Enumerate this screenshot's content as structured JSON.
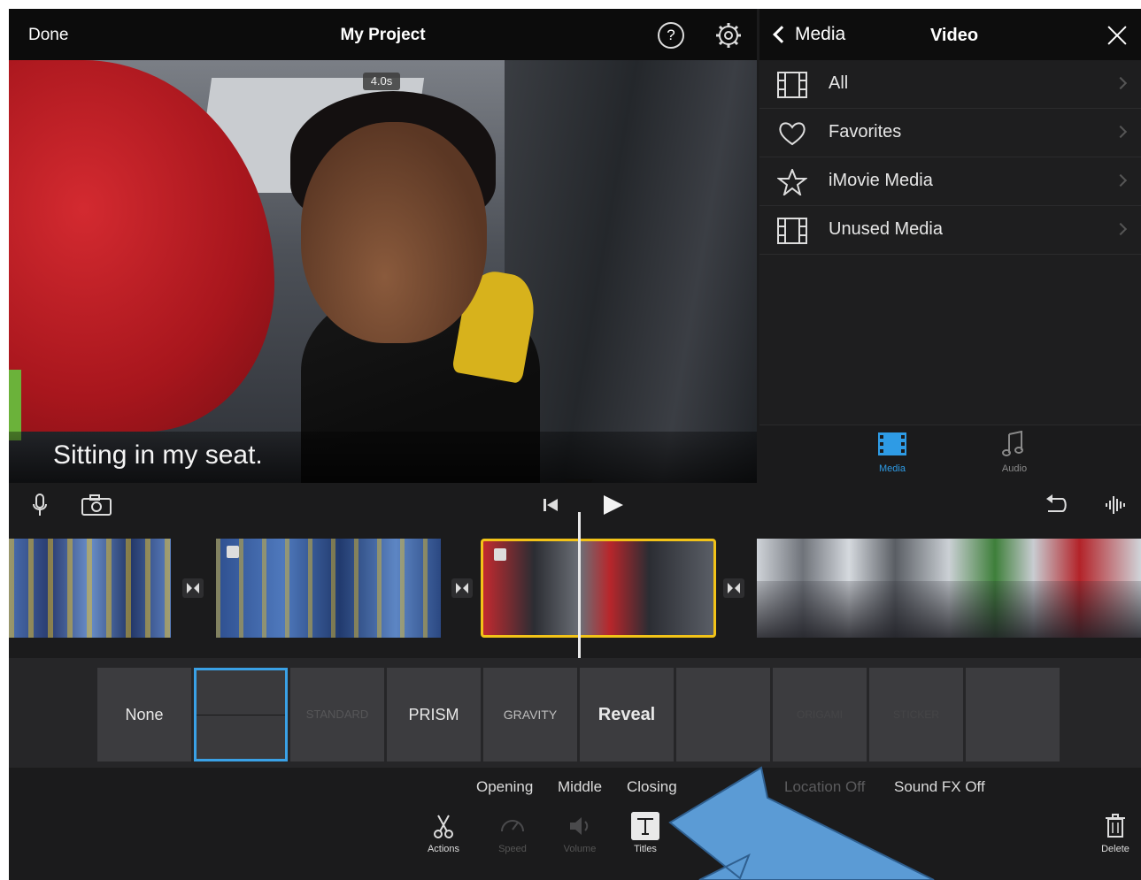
{
  "viewer": {
    "done_label": "Done",
    "project_title": "My Project",
    "help_label": "?",
    "clip_duration": "4.0s",
    "title_overlay_text": "Sitting in my seat."
  },
  "browser": {
    "back_label": "Media",
    "title": "Video",
    "rows": [
      {
        "label": "All",
        "icon": "film-icon"
      },
      {
        "label": "Favorites",
        "icon": "heart-icon"
      },
      {
        "label": "iMovie Media",
        "icon": "star-icon"
      },
      {
        "label": "Unused Media",
        "icon": "film-icon"
      }
    ],
    "tabs": {
      "media_label": "Media",
      "audio_label": "Audio"
    }
  },
  "title_styles": [
    {
      "label": "None"
    },
    {
      "label": ""
    },
    {
      "label": "STANDARD"
    },
    {
      "label": "PRISM"
    },
    {
      "label": "GRAVITY"
    },
    {
      "label": "Reveal"
    },
    {
      "label": ""
    },
    {
      "label": "ORIGAMI"
    },
    {
      "label": "STICKER"
    },
    {
      "label": ""
    }
  ],
  "options": {
    "opening": "Opening",
    "middle": "Middle",
    "closing": "Closing",
    "location": "Location Off",
    "sound_fx": "Sound FX Off"
  },
  "toolbar": {
    "actions": "Actions",
    "speed": "Speed",
    "volume": "Volume",
    "titles": "Titles",
    "delete": "Delete"
  },
  "colors": {
    "accent_blue": "#3aa1e6",
    "selected_clip_yellow": "#f2c318",
    "callout_arrow": "#5b9bd5"
  }
}
